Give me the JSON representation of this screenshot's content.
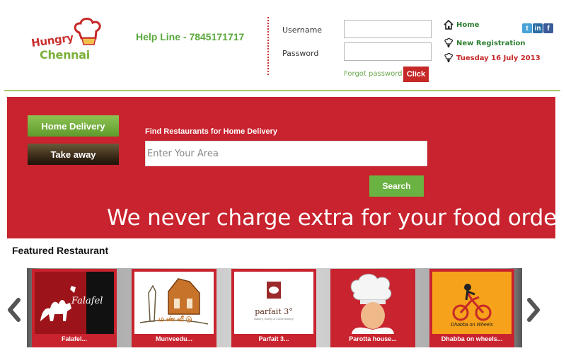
{
  "header": {
    "logo_line1": "Hungry",
    "logo_line2": "Chennai",
    "helpline": "Help Line - 7845171717",
    "login": {
      "username_label": "Username",
      "password_label": "Password",
      "username_value": "",
      "password_value": "",
      "forgot_label": "Forgot password ?",
      "click_label": "Click"
    },
    "links": {
      "home": "Home",
      "new_registration": "New Registration",
      "date": "Tuesday 16 July 2013"
    },
    "social": [
      "t",
      "in",
      "f"
    ]
  },
  "banner": {
    "tabs": {
      "home_delivery": "Home Delivery",
      "take_away": "Take away"
    },
    "find_label": "Find Restaurants for Home Delivery",
    "area_placeholder": "Enter Your Area",
    "search_label": "Search",
    "slogan": "We never charge extra for your food order"
  },
  "featured": {
    "title": "Featured Restaurant",
    "restaurants": [
      {
        "name": "Falafel...",
        "logo_text": "Falafel"
      },
      {
        "name": "Munveedu...",
        "logo_text": "ம ண் வீ டு"
      },
      {
        "name": "Parfait 3...",
        "logo_text": "parfait 3°",
        "logo_sub": "Bakery, Eatery & Confectionery"
      },
      {
        "name": "Parotta house...",
        "logo_text": ""
      },
      {
        "name": "Dhabba on wheels...",
        "logo_text": "Dhabba on Wheels"
      }
    ]
  },
  "colors": {
    "brand_red": "#c8232e",
    "brand_green": "#6ab242",
    "helpline_green": "#5aa83c"
  }
}
